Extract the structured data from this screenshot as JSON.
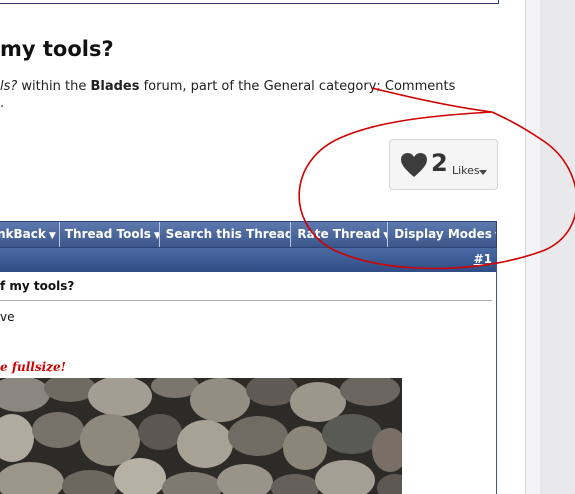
{
  "thread": {
    "title": "my tools?",
    "desc_part1": "ls?",
    "desc_part2": " within the ",
    "desc_forum": "Blades",
    "desc_part3": " forum, part of the General category; Comments",
    "desc_line2": "."
  },
  "likes": {
    "count": "2",
    "label": "Likes",
    "heart_icon": "heart-icon",
    "caret_icon": "chevron-down-icon"
  },
  "toolbar": {
    "items": [
      {
        "label": "nkBack"
      },
      {
        "label": "Thread Tools"
      },
      {
        "label": "Search this Thread"
      },
      {
        "label": "Rate Thread"
      },
      {
        "label": "Display Modes"
      }
    ],
    "caret": "▼"
  },
  "post": {
    "number_prefix": "#",
    "number": "1",
    "title": "f my tools?",
    "text": "ve",
    "fullsize_link": "e fullsize!"
  },
  "colors": {
    "toolbar": "#4a67a0",
    "annotation": "#d10000",
    "link_red": "#cc0000"
  }
}
